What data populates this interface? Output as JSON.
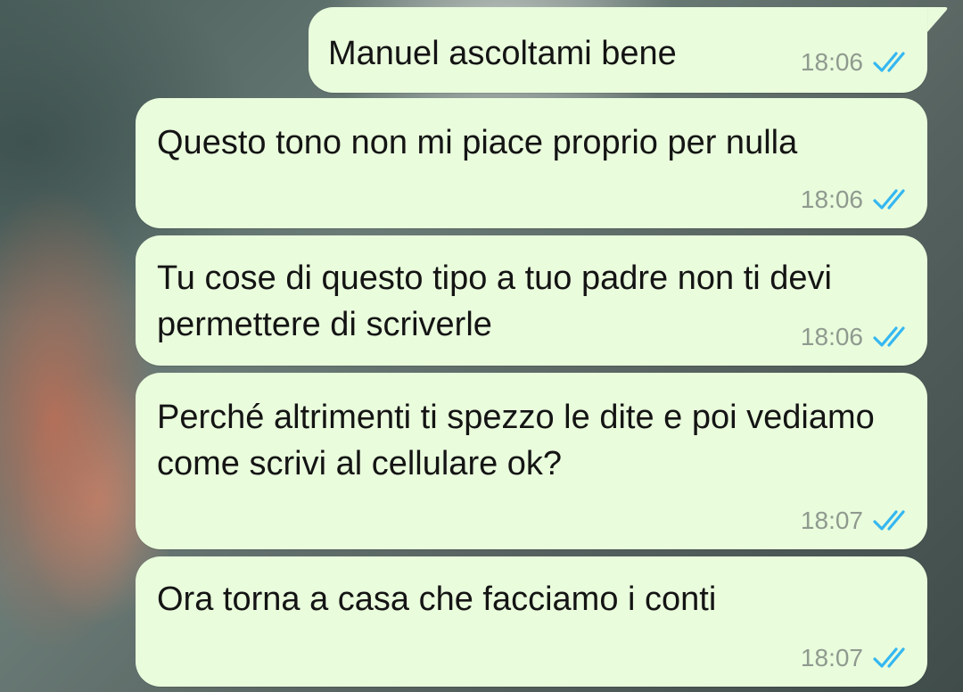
{
  "colors": {
    "bubble_background": "#e9fcdc",
    "text": "#141414",
    "timestamp": "#8f9a8f",
    "read_ticks": "#34b7f1"
  },
  "messages": [
    {
      "text": "Manuel ascoltami bene",
      "time": "18:06",
      "status_icon": "double-check-read-icon"
    },
    {
      "text": "Questo tono non mi piace proprio per nulla",
      "time": "18:06",
      "status_icon": "double-check-read-icon"
    },
    {
      "text": "Tu cose di questo tipo a tuo padre non ti devi permettere di scriverle",
      "time": "18:06",
      "status_icon": "double-check-read-icon"
    },
    {
      "text": "Perché altrimenti ti spezzo le dite e poi vediamo come scrivi al cellulare ok?",
      "time": "18:07",
      "status_icon": "double-check-read-icon"
    },
    {
      "text": "Ora torna a casa che facciamo i conti",
      "time": "18:07",
      "status_icon": "double-check-read-icon"
    }
  ]
}
